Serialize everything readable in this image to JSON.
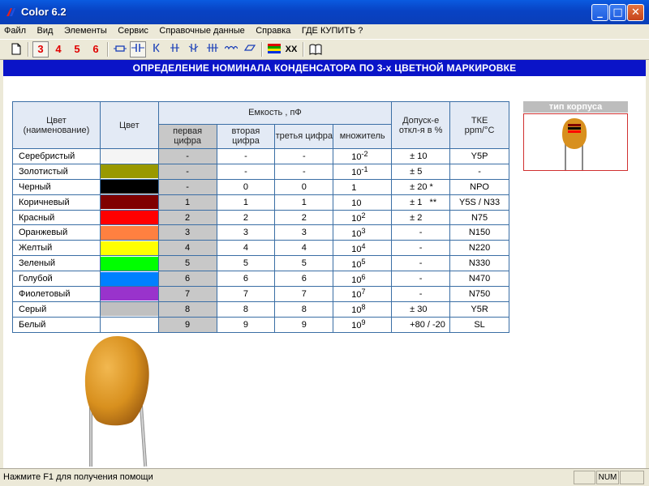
{
  "window": {
    "title": "Color 6.2",
    "minimize": "_",
    "maximize": "□",
    "close": "✕"
  },
  "menu": [
    "Файл",
    "Вид",
    "Элементы",
    "Сервис",
    "Справочные данные",
    "Справка",
    "ГДЕ КУПИТЬ ?"
  ],
  "toolbar": {
    "n3": "3",
    "n4": "4",
    "n5": "5",
    "n6": "6",
    "xx": "XX"
  },
  "banner": "ОПРЕДЕЛЕНИЕ НОМИНАЛА КОНДЕНСАТОРА ПО 3-х ЦВЕТНОЙ МАРКИРОВКЕ",
  "table": {
    "headers": {
      "name": "Цвет\n(наименование)",
      "color": "Цвет",
      "capacity": "Емкость , пФ",
      "d1": "первая цифра",
      "d2": "вторая цифра",
      "d3": "третья цифра",
      "mult": "множитель",
      "tolerance": "Допуск-е откл-я в %",
      "tke": "ТКЕ",
      "tke_unit": "ppm/°C"
    },
    "rows": [
      {
        "name": "Серебристый",
        "color": "#f5f5f5",
        "d1": "-",
        "d2": "-",
        "d3": "-",
        "mult": "10",
        "exp": "-2",
        "tol": "± 10",
        "tke": "Y5P"
      },
      {
        "name": "Золотистый",
        "color": "#999900",
        "d1": "-",
        "d2": "-",
        "d3": "-",
        "mult": "10",
        "exp": "-1",
        "tol": "± 5",
        "tke": "-"
      },
      {
        "name": "Черный",
        "color": "#000000",
        "d1": "-",
        "d2": "0",
        "d3": "0",
        "mult": "1",
        "exp": "",
        "tol": "± 20 *",
        "tke": "NPO"
      },
      {
        "name": "Коричневый",
        "color": "#800000",
        "d1": "1",
        "d2": "1",
        "d3": "1",
        "mult": "10",
        "exp": "",
        "tol": "± 1   **",
        "tke": "Y5S / N33"
      },
      {
        "name": "Красный",
        "color": "#ff0000",
        "d1": "2",
        "d2": "2",
        "d3": "2",
        "mult": "10",
        "exp": "2",
        "tol": "± 2",
        "tke": "N75"
      },
      {
        "name": "Оранжевый",
        "color": "#ff8040",
        "d1": "3",
        "d2": "3",
        "d3": "3",
        "mult": "10",
        "exp": "3",
        "tol": "-",
        "tke": "N150"
      },
      {
        "name": "Желтый",
        "color": "#ffff00",
        "d1": "4",
        "d2": "4",
        "d3": "4",
        "mult": "10",
        "exp": "4",
        "tol": "-",
        "tke": "N220"
      },
      {
        "name": "Зеленый",
        "color": "#00ff00",
        "d1": "5",
        "d2": "5",
        "d3": "5",
        "mult": "10",
        "exp": "5",
        "tol": "-",
        "tke": "N330"
      },
      {
        "name": "Голубой",
        "color": "#0080ff",
        "d1": "6",
        "d2": "6",
        "d3": "6",
        "mult": "10",
        "exp": "6",
        "tol": "-",
        "tke": "N470"
      },
      {
        "name": "Фиолетовый",
        "color": "#9933cc",
        "d1": "7",
        "d2": "7",
        "d3": "7",
        "mult": "10",
        "exp": "7",
        "tol": "-",
        "tke": "N750"
      },
      {
        "name": "Серый",
        "color": "#c0c0c0",
        "d1": "8",
        "d2": "8",
        "d3": "8",
        "mult": "10",
        "exp": "8",
        "tol": "± 30",
        "tke": "Y5R"
      },
      {
        "name": "Белый",
        "color": "#ffffff",
        "d1": "9",
        "d2": "9",
        "d3": "9",
        "mult": "10",
        "exp": "9",
        "tol": "+80 / -20",
        "tke": "SL"
      }
    ]
  },
  "panel": {
    "type_label": "тип корпуса"
  },
  "status": {
    "message": "Нажмите F1 для получения помощи",
    "num": "NUM"
  },
  "colors": {
    "banner_bg": "#0a14c8",
    "header_bg": "#e3eaf5",
    "gray_col": "#c8c8c8",
    "capacitor_body": "#d8901e"
  }
}
